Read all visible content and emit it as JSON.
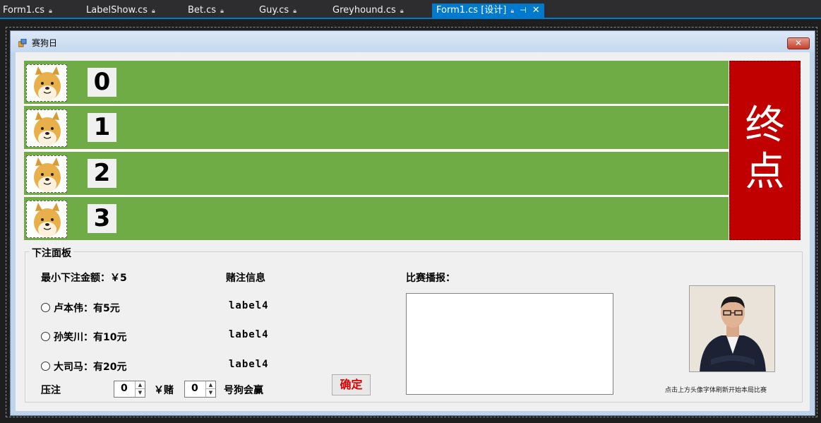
{
  "tabs": [
    {
      "label": "Form1.cs",
      "locked": true
    },
    {
      "label": "LabelShow.cs",
      "locked": true
    },
    {
      "label": "Bet.cs",
      "locked": true
    },
    {
      "label": "Guy.cs",
      "locked": true
    },
    {
      "label": "Greyhound.cs",
      "locked": true
    },
    {
      "label": "Form1.cs [设计]",
      "active": true
    }
  ],
  "icons": {
    "lock": "lock-icon",
    "pin": "pin-icon",
    "tab_close": "close-icon",
    "window_close": "close-icon",
    "form_icon": "app-icon"
  },
  "colors": {
    "accent": "#007acc",
    "track": "#6fac46",
    "finish": "#c00000",
    "confirm_text": "#e00000"
  },
  "form": {
    "title": "赛狗日",
    "close_label": "✕"
  },
  "track": {
    "lanes": [
      {
        "number": "0"
      },
      {
        "number": "1"
      },
      {
        "number": "2"
      },
      {
        "number": "3"
      }
    ],
    "finish_label": "终\n点"
  },
  "bet_panel": {
    "title": "下注面板",
    "min_bet": "最小下注金额：￥5",
    "bet_info_header": "赌注信息",
    "broadcast_header": "比赛播报：",
    "guys": [
      {
        "label": "卢本伟：有5元",
        "bet_label": "label4"
      },
      {
        "label": "孙笑川：有10元",
        "bet_label": "label4"
      },
      {
        "label": "大司马：有20元",
        "bet_label": "label4"
      }
    ],
    "bet_prefix": "压注",
    "amount_value": "0",
    "yuan_bet": "￥赌",
    "dog_value": "0",
    "dog_suffix": "号狗会赢",
    "confirm_label": "确定",
    "photo_caption": "点击上方头像字体刷新开始本局比赛"
  }
}
